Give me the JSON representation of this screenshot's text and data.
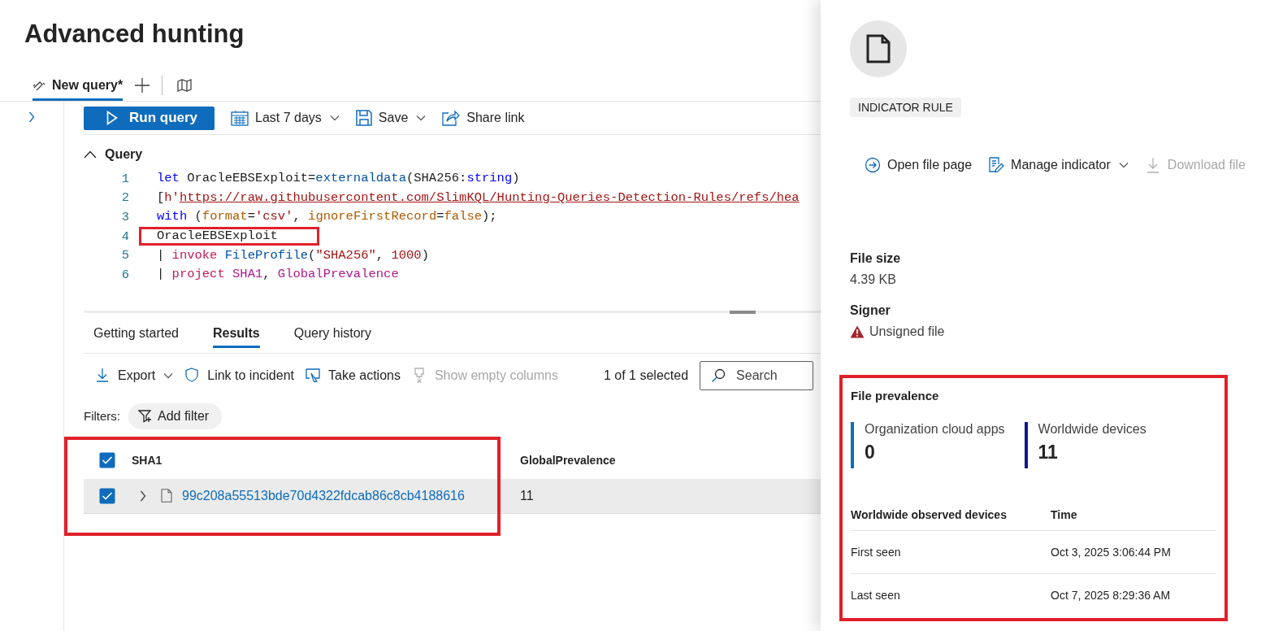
{
  "page": {
    "title": "Advanced hunting"
  },
  "query_tabs": [
    {
      "label": "New query*",
      "selected": true
    }
  ],
  "toolbar": {
    "run_button": "Run query",
    "time_range": "Last 7 days",
    "save": "Save",
    "share": "Share link"
  },
  "query": {
    "title": "Query",
    "expanded": true,
    "lines": [
      {
        "number": "1",
        "highlighted": false,
        "tokens": [
          {
            "kind": "keyword",
            "text": "let"
          },
          {
            "kind": "plain",
            "text": " OracleEBSExploit="
          },
          {
            "kind": "function",
            "text": "externaldata"
          },
          {
            "kind": "plain",
            "text": "(SHA256:"
          },
          {
            "kind": "keyword",
            "text": "string"
          },
          {
            "kind": "plain",
            "text": ")"
          }
        ]
      },
      {
        "number": "2",
        "highlighted": false,
        "tokens": [
          {
            "kind": "plain",
            "text": "["
          },
          {
            "kind": "string",
            "text": "h'"
          },
          {
            "kind": "url",
            "text": "https://raw.githubusercontent.com/SlimKQL/Hunting-Queries-Detection-Rules/refs/hea"
          }
        ]
      },
      {
        "number": "3",
        "highlighted": false,
        "tokens": [
          {
            "kind": "keyword",
            "text": "with"
          },
          {
            "kind": "plain",
            "text": " ("
          },
          {
            "kind": "param",
            "text": "format"
          },
          {
            "kind": "plain",
            "text": "="
          },
          {
            "kind": "string",
            "text": "'csv'"
          },
          {
            "kind": "plain",
            "text": ", "
          },
          {
            "kind": "param",
            "text": "ignoreFirstRecord"
          },
          {
            "kind": "plain",
            "text": "="
          },
          {
            "kind": "param",
            "text": "false"
          },
          {
            "kind": "plain",
            "text": ");"
          }
        ]
      },
      {
        "number": "4",
        "highlighted": true,
        "tokens": [
          {
            "kind": "plain",
            "text": "OracleEBSExploit"
          }
        ]
      },
      {
        "number": "5",
        "highlighted": false,
        "tokens": [
          {
            "kind": "plain",
            "text": "| "
          },
          {
            "kind": "operator",
            "text": "invoke",
            "space_after": true
          },
          {
            "kind": "function",
            "text": "FileProfile"
          },
          {
            "kind": "plain",
            "text": "("
          },
          {
            "kind": "string",
            "text": "\"SHA256\""
          },
          {
            "kind": "plain",
            "text": ", "
          },
          {
            "kind": "string",
            "text": "1000"
          },
          {
            "kind": "plain",
            "text": ")"
          }
        ]
      },
      {
        "number": "6",
        "highlighted": false,
        "tokens": [
          {
            "kind": "plain",
            "text": "| "
          },
          {
            "kind": "operator",
            "text": "project",
            "space_after": true
          },
          {
            "kind": "column",
            "text": "SHA1"
          },
          {
            "kind": "plain",
            "text": ", "
          },
          {
            "kind": "column",
            "text": "GlobalPrevalence"
          }
        ]
      }
    ]
  },
  "result_tabs": [
    {
      "label": "Getting started",
      "selected": false
    },
    {
      "label": "Results",
      "selected": true
    },
    {
      "label": "Query history",
      "selected": false
    }
  ],
  "results_toolbar": {
    "actions": [
      {
        "kind": "export",
        "label": "Export",
        "disabled": false
      },
      {
        "kind": "incident",
        "label": "Link to incident",
        "disabled": false
      },
      {
        "kind": "actions",
        "label": "Take actions",
        "disabled": false
      },
      {
        "kind": "columns",
        "label": "Show empty columns",
        "disabled": true
      }
    ],
    "selection": "1 of 1 selected",
    "search": {
      "placeholder": "Search"
    }
  },
  "filters": {
    "label": "Filters:",
    "add_button": "Add filter"
  },
  "table": {
    "highlighted": true,
    "all_checked": true,
    "columns": [
      "SHA1",
      "GlobalPrevalence"
    ],
    "rows": [
      {
        "checked": true,
        "expanded": false,
        "sha1": "99c208a55513bde70d4322fdcab86c8cb4188616",
        "global_prevalence": "11"
      }
    ]
  },
  "panel": {
    "badge": "INDICATOR RULE",
    "actions": [
      {
        "kind": "open",
        "label": "Open file page",
        "disabled": false
      },
      {
        "kind": "manage",
        "label": "Manage indicator",
        "disabled": false
      },
      {
        "kind": "download",
        "label": "Download file",
        "disabled": true
      }
    ],
    "fields": [
      {
        "label": "File size",
        "value": "4.39 KB",
        "warning": false
      },
      {
        "label": "Signer",
        "value": "Unsigned file",
        "warning": true
      }
    ],
    "prevalence": {
      "highlighted": true,
      "title": "File prevalence",
      "stats": [
        {
          "label": "Organization cloud apps",
          "value": "0",
          "color": "#0f6cbd"
        },
        {
          "label": "Worldwide devices",
          "value": "11",
          "color": "#0b1a8a"
        }
      ],
      "columns": [
        "Worldwide observed devices",
        "Time"
      ],
      "rows": [
        {
          "event": "First seen",
          "time": "Oct 3, 2025 3:06:44 PM"
        },
        {
          "event": "Last seen",
          "time": "Oct 7, 2025 8:29:36 AM"
        }
      ]
    }
  }
}
